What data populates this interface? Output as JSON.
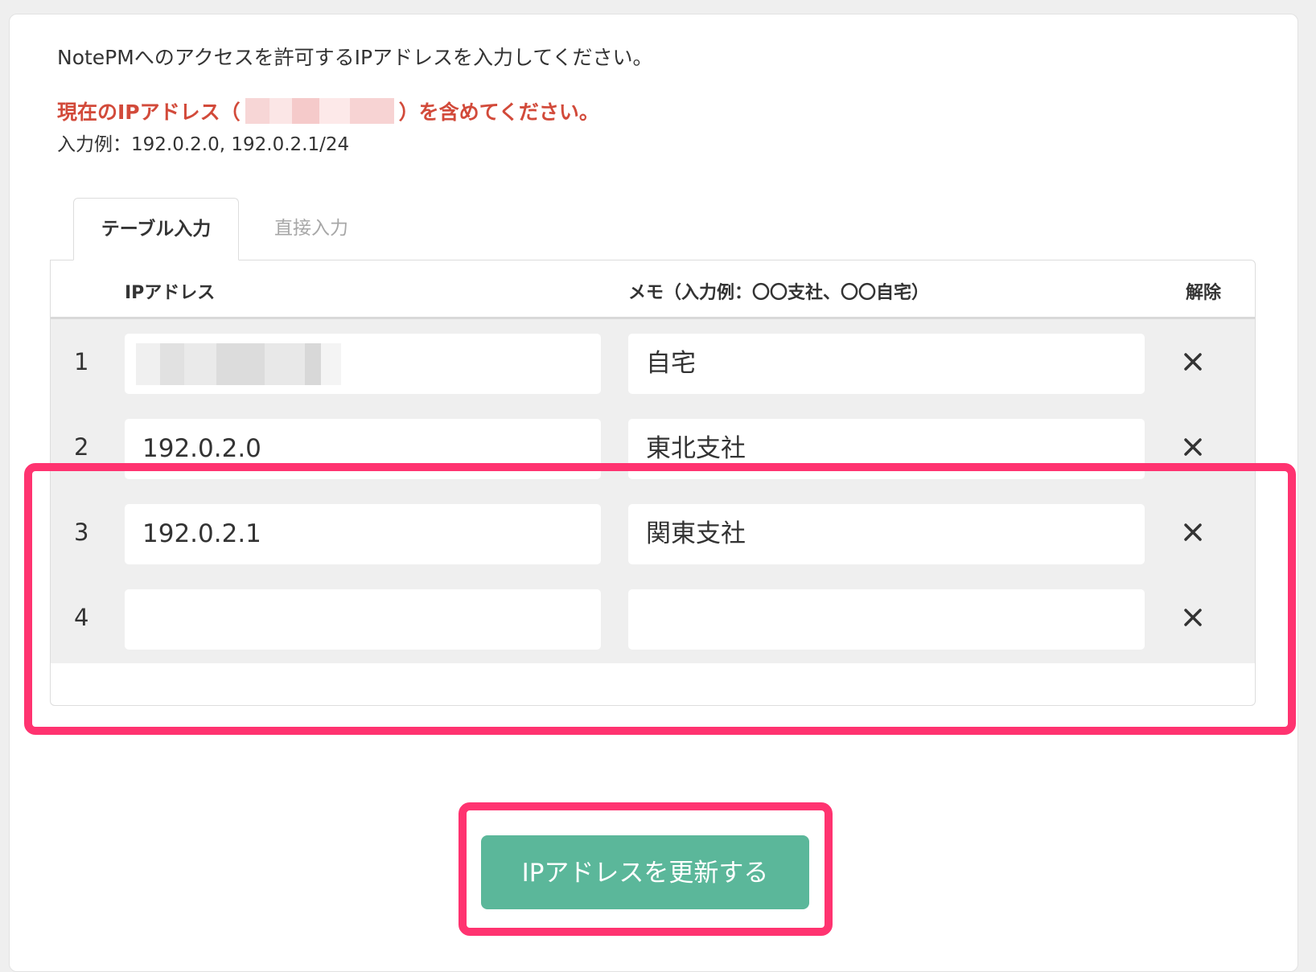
{
  "intro": "NotePMへのアクセスを許可するIPアドレスを入力してください。",
  "current_ip": {
    "prefix": "現在のIPアドレス（",
    "suffix": "）を含めてください。"
  },
  "example": "入力例：192.0.2.0, 192.0.2.1/24",
  "tabs": [
    {
      "label": "テーブル入力",
      "active": true
    },
    {
      "label": "直接入力",
      "active": false
    }
  ],
  "table": {
    "headers": {
      "ip": "IPアドレス",
      "memo": "メモ（入力例：〇〇支社、〇〇自宅）",
      "remove": "解除"
    },
    "rows": [
      {
        "num": "1",
        "ip": "",
        "memo": "自宅"
      },
      {
        "num": "2",
        "ip": "192.0.2.0",
        "memo": "東北支社"
      },
      {
        "num": "3",
        "ip": "192.0.2.1",
        "memo": "関東支社"
      },
      {
        "num": "4",
        "ip": "",
        "memo": ""
      }
    ]
  },
  "update_button": "IPアドレスを更新する",
  "colors": {
    "accent_green": "#5bb79a",
    "warning_red": "#d24a3a",
    "highlight_pink": "#ff3370"
  },
  "icons": {
    "remove": "close-icon"
  }
}
